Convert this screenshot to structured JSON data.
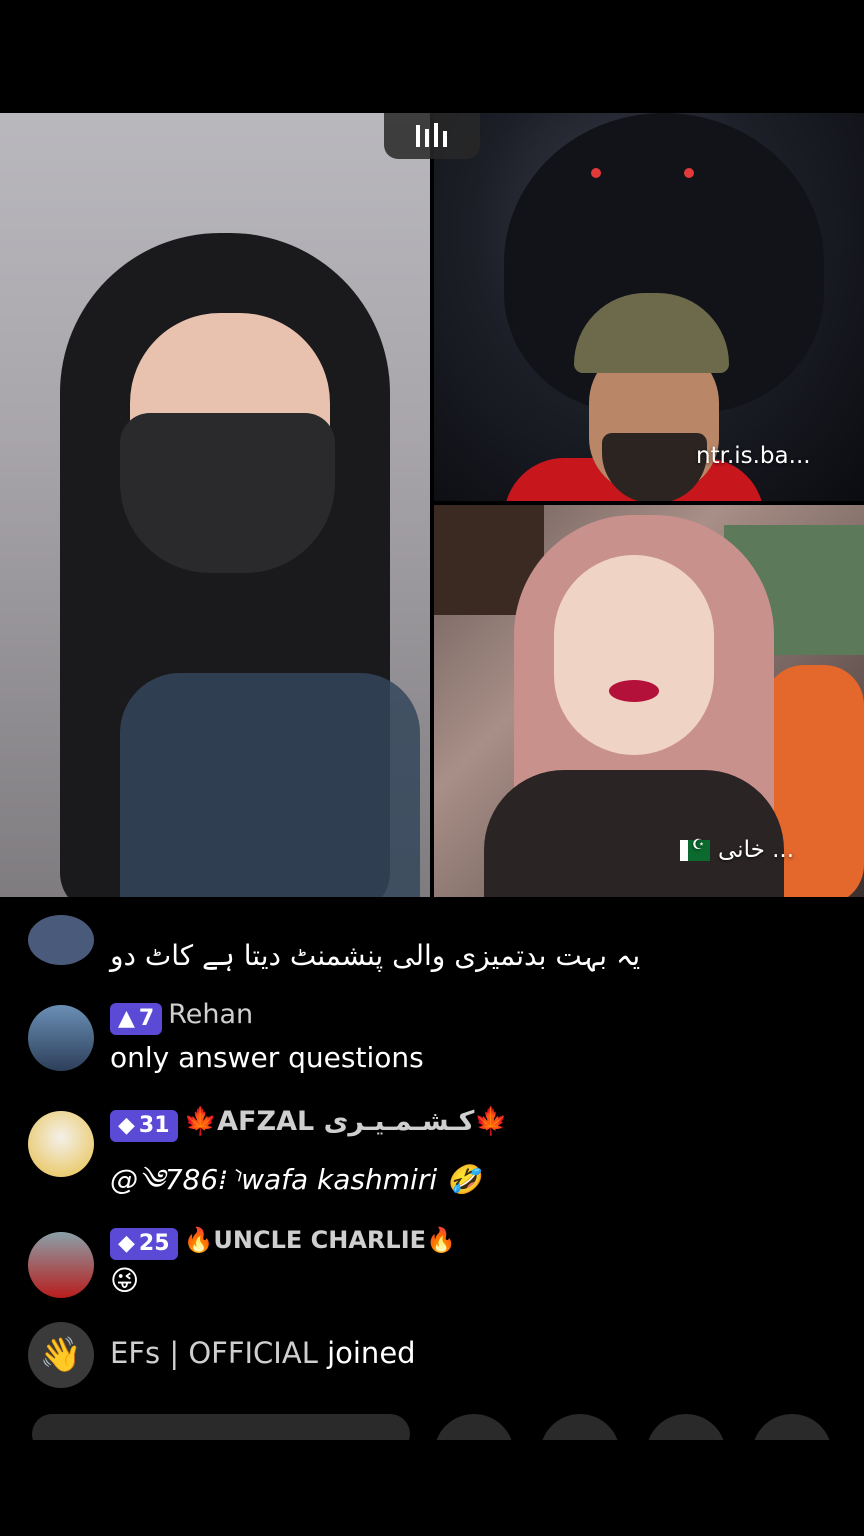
{
  "video_tiles": {
    "top_right_name": "ntr.is.ba...",
    "bottom_right_name": "خانی ..."
  },
  "comments": [
    {
      "username": "",
      "message": "یہ بہت بدتمیزی والی پنشمنٹ دیتا ہے کاٹ دو"
    },
    {
      "badge_level": "7",
      "username": "Rehan",
      "message": "only answer questions"
    },
    {
      "badge_level": "31",
      "username": "🍁AFZAL کـشـمـیـری🍁",
      "message": "@༄786⁞⸃wafa kashmiri 🤣"
    },
    {
      "badge_level": "25",
      "username": "🔥UNCLE CHARLIE🔥",
      "message": "😜"
    }
  ],
  "join_notice": {
    "username": "EFs | OFFICIAL",
    "action": "joined"
  },
  "icons": {
    "pause": "pause-audio-icon",
    "wave": "wave-hand-icon",
    "badge": "diamond-icon"
  },
  "colors": {
    "badge": "#5a4ad6",
    "background": "#000000"
  }
}
